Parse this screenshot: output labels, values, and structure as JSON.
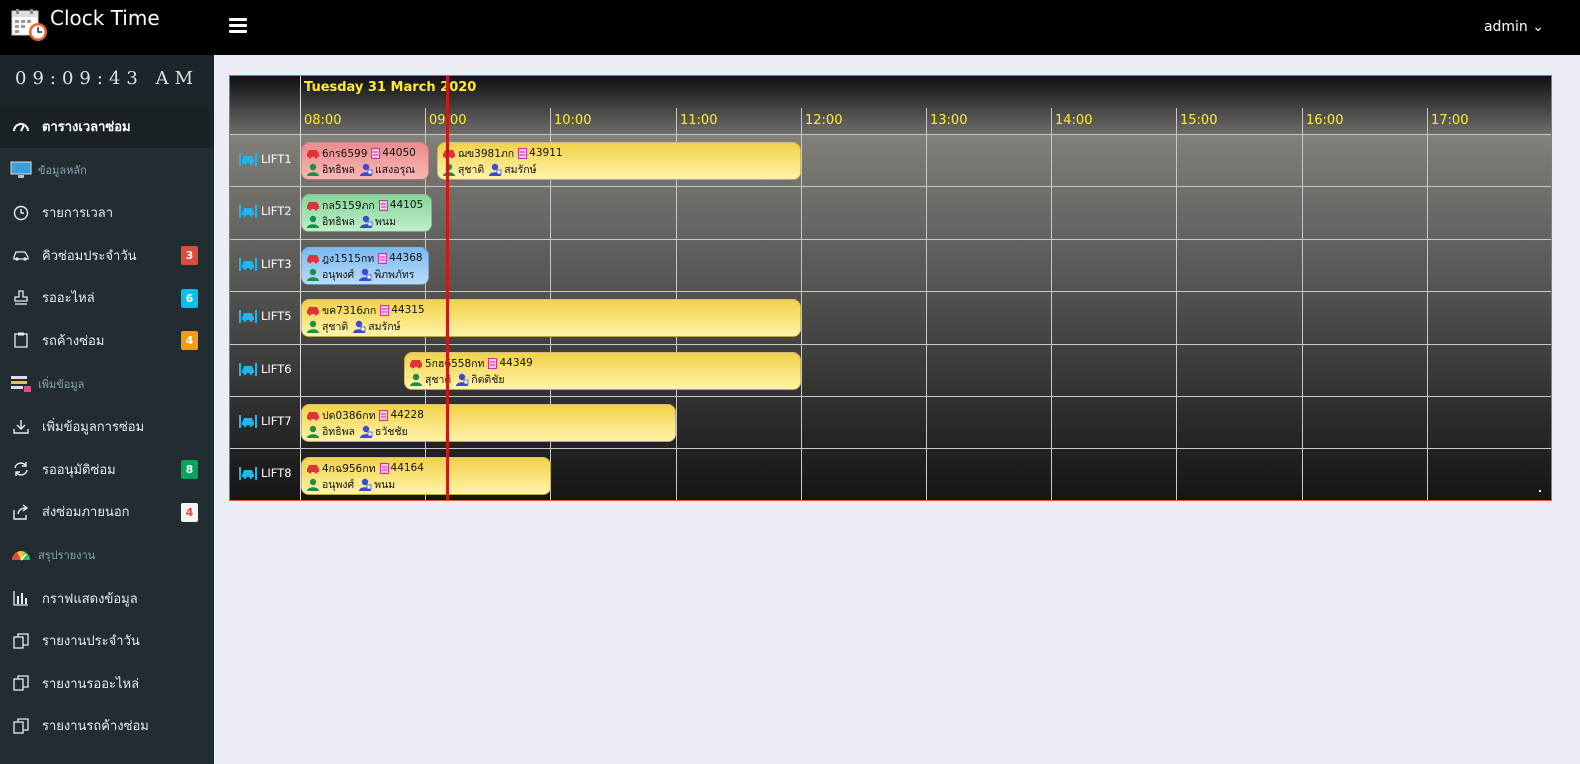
{
  "app": {
    "title": "Clock Time"
  },
  "header": {
    "user": "admin"
  },
  "clock": "09:09:43 AM",
  "nav": {
    "schedule": "ตารางเวลาซ่อม",
    "master_header": "ข้อมูลหลัก",
    "time_list": "รายการเวลา",
    "daily_queue": "คิวซ่อมประจำวัน",
    "waiting_parts": "รออะไหล่",
    "pending_cars": "รถค้างซ่อม",
    "add_header": "เพิ่มข้อมูล",
    "add_repair": "เพิ่มข้อมูลการซ่อม",
    "waiting_approval": "รออนุมัติซ่อม",
    "outsourced": "ส่งซ่อมภายนอก",
    "report_header": "สรุปรายงาน",
    "graph": "กราฟแสดงข้อมูล",
    "daily_report": "รายงานประจำวัน",
    "parts_report": "รายงานรออะไหล่",
    "pending_report": "รายงานรถค้างซ่อม"
  },
  "badges": {
    "daily_queue": "3",
    "waiting_parts": "6",
    "pending_cars": "4",
    "waiting_approval": "8",
    "outsourced": "4"
  },
  "badge_colors": {
    "daily_queue": "#dd4b39",
    "waiting_parts": "#00c0ef",
    "pending_cars": "#f39c12",
    "waiting_approval": "#00a65a",
    "outsourced": "#f4f4f4"
  },
  "board": {
    "date": "Tuesday 31 March 2020",
    "hours": [
      "08:00",
      "09:00",
      "10:00",
      "11:00",
      "12:00",
      "13:00",
      "14:00",
      "15:00",
      "16:00",
      "17:00"
    ],
    "lifts": [
      "LIFT1",
      "LIFT2",
      "LIFT3",
      "LIFT5",
      "LIFT6",
      "LIFT7",
      "LIFT8"
    ],
    "jobs": [
      {
        "lift": "LIFT1",
        "plate": "6กร6599",
        "doc": "44050",
        "tech": "อิทธิพล",
        "advisor": "แสงอรุณ",
        "color": "red"
      },
      {
        "lift": "LIFT1",
        "plate": "ฌข3981ภก",
        "doc": "43911",
        "tech": "สุชาติ",
        "advisor": "สมรักษ์",
        "color": "yellow"
      },
      {
        "lift": "LIFT2",
        "plate": "กล5159ภก",
        "doc": "44105",
        "tech": "อิทธิพล",
        "advisor": "พนม",
        "color": "green"
      },
      {
        "lift": "LIFT3",
        "plate": "ฎง1515กท",
        "doc": "44368",
        "tech": "อนุพงศ์",
        "advisor": "พิภพภัทร",
        "color": "blue"
      },
      {
        "lift": "LIFT5",
        "plate": "ขค7316ภก",
        "doc": "44315",
        "tech": "สุชาติ",
        "advisor": "สมรักษ์",
        "color": "yellow"
      },
      {
        "lift": "LIFT6",
        "plate": "5กฮ6558กท",
        "doc": "44349",
        "tech": "สุชาติ",
        "advisor": "กิตติชัย",
        "color": "yellow"
      },
      {
        "lift": "LIFT7",
        "plate": "ปด0386กท",
        "doc": "44228",
        "tech": "อิทธิพล",
        "advisor": "ธวัชชัย",
        "color": "yellow"
      },
      {
        "lift": "LIFT8",
        "plate": "4กฉ956กท",
        "doc": "44164",
        "tech": "อนุพงศ์",
        "advisor": "พนม",
        "color": "yellow"
      }
    ]
  }
}
